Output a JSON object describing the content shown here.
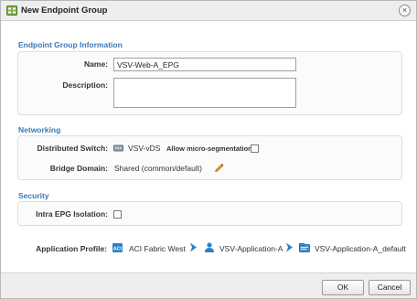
{
  "dialog": {
    "title": "New Endpoint Group",
    "close_glyph": "×",
    "icons": {
      "title": "endpoint-group-icon",
      "close": "close-icon"
    }
  },
  "endpoint_group_info": {
    "heading": "Endpoint Group Information",
    "name_label": "Name:",
    "name_value": "VSV-Web-A_EPG",
    "description_label": "Description:",
    "description_value": ""
  },
  "networking": {
    "heading": "Networking",
    "distributed_switch_label": "Distributed Switch:",
    "distributed_switch_value": "VSV-vDS",
    "micro_segmentation_label": "Allow micro-segmentation:",
    "micro_segmentation_checked": false,
    "bridge_domain_label": "Bridge Domain:",
    "bridge_domain_value": "Shared (common/default)",
    "icons": {
      "switch": "network-switch-icon",
      "edit": "pencil-edit-icon"
    }
  },
  "security": {
    "heading": "Security",
    "intra_epg_label": "Intra EPG Isolation:",
    "intra_epg_checked": false
  },
  "application_profile": {
    "label": "Application Profile:",
    "path": [
      {
        "text": "ACI Fabric West",
        "icon": "aci-fabric-icon"
      },
      {
        "text": "VSV-Application-A",
        "icon": "tenant-users-icon"
      },
      {
        "text": "VSV-Application-A_default",
        "icon": "application-profile-icon"
      }
    ],
    "separator_icon": "chevron-right-icon"
  },
  "footer": {
    "ok_label": "OK",
    "cancel_label": "Cancel"
  },
  "colors": {
    "section_heading": "#3a78b4",
    "icon_blue": "#2f7fc1",
    "pencil": "#d49a1a"
  }
}
